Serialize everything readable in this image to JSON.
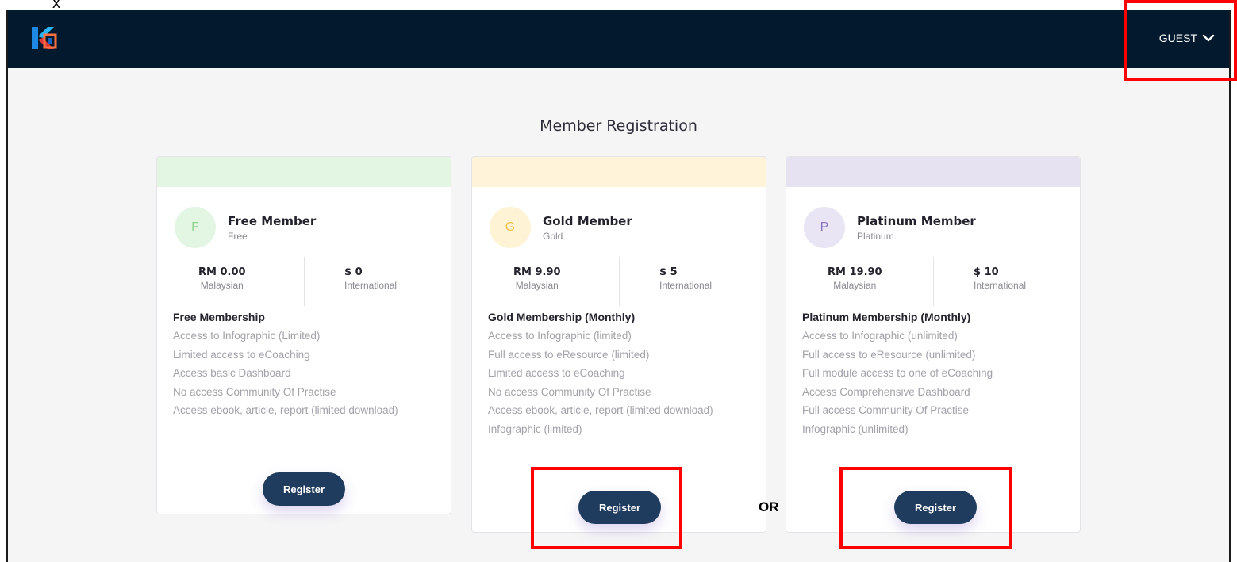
{
  "annotation_mark": "x",
  "header": {
    "guest_label": "GUEST"
  },
  "page_title": "Member Registration",
  "plans": [
    {
      "initial": "F",
      "name": "Free Member",
      "subtitle": "Free",
      "price_local": "RM 0.00",
      "price_local_label": "Malaysian",
      "price_intl": "$ 0",
      "price_intl_label": "International",
      "features_title": "Free Membership",
      "features": [
        "Access to Infographic (Limited)",
        "Limited access to eCoaching",
        "Access basic Dashboard",
        "No access Community Of Practise",
        "Access ebook, article, report (limited download)"
      ],
      "button_label": "Register",
      "band_color": "#e3f6e3",
      "avatar_bg": "#e3f6e3",
      "avatar_color": "#8fd48f"
    },
    {
      "initial": "G",
      "name": "Gold Member",
      "subtitle": "Gold",
      "price_local": "RM 9.90",
      "price_local_label": "Malaysian",
      "price_intl": "$ 5",
      "price_intl_label": "International",
      "features_title": "Gold Membership (Monthly)",
      "features": [
        "Access to Infographic (limited)",
        "Full access to eResource (limited)",
        "Limited access to eCoaching",
        "No access Community Of Practise",
        "Access ebook, article, report (limited download)",
        "Infographic (limited)"
      ],
      "button_label": "Register",
      "band_color": "#fff4d9",
      "avatar_bg": "#fff3d6",
      "avatar_color": "#f4c04a"
    },
    {
      "initial": "P",
      "name": "Platinum Member",
      "subtitle": "Platinum",
      "price_local": "RM 19.90",
      "price_local_label": "Malaysian",
      "price_intl": "$ 10",
      "price_intl_label": "International",
      "features_title": "Platinum Membership (Monthly)",
      "features": [
        "Access to Infographic (unlimited)",
        "Full access to eResource (unlimited)",
        "Full module access to one of eCoaching",
        "Access Comprehensive Dashboard",
        "Full access Community Of Practise",
        "Infographic (unlimited)"
      ],
      "button_label": "Register",
      "band_color": "#e6e2f2",
      "avatar_bg": "#e9e5f4",
      "avatar_color": "#8a73c4"
    }
  ],
  "or_label": "OR",
  "colors": {
    "navbar": "#031a2e",
    "button": "#1f3c5e",
    "highlight": "#ff0000"
  }
}
